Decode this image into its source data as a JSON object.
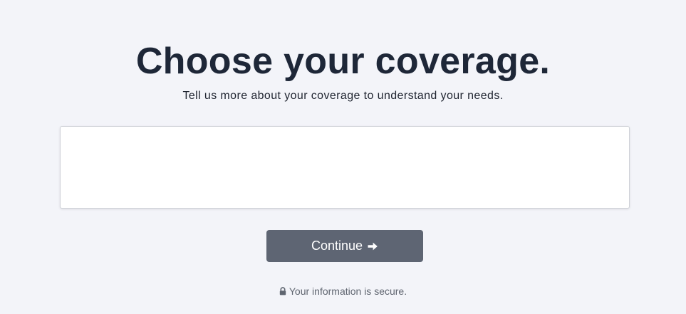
{
  "header": {
    "title": "Choose your coverage.",
    "subtitle": "Tell us more about your coverage to understand your needs."
  },
  "actions": {
    "continue_label": "Continue"
  },
  "footer": {
    "secure_text": "Your information is secure."
  },
  "icons": {
    "continue": "arrow-right-icon",
    "secure": "lock-icon"
  },
  "colors": {
    "background": "#f3f4f9",
    "title": "#1e2738",
    "button": "#5e6573",
    "button_text": "#ffffff",
    "muted_text": "#5f6570"
  }
}
